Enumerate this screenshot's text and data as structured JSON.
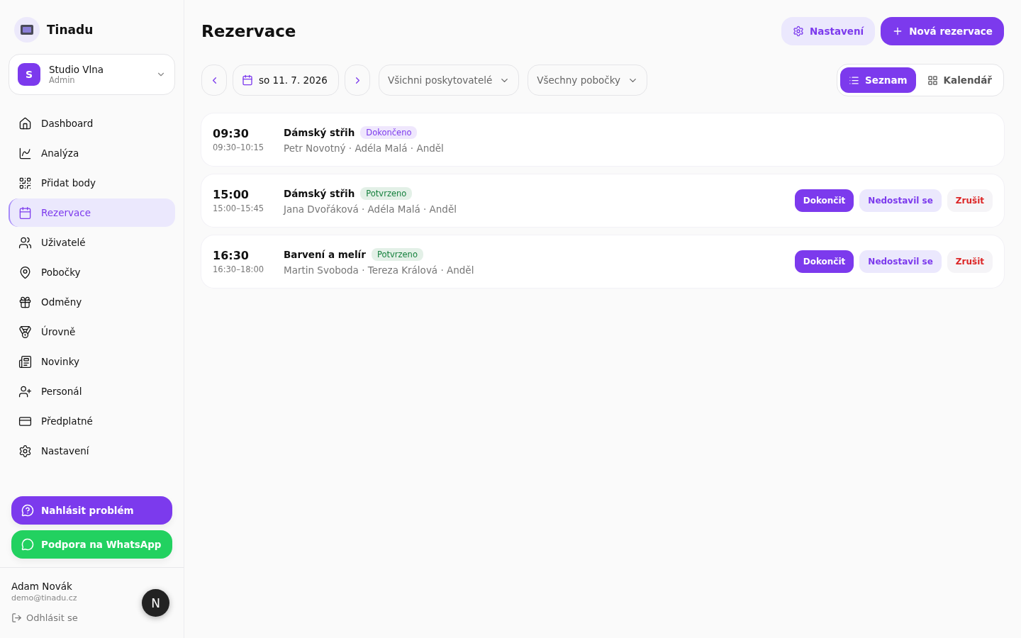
{
  "brand": {
    "name": "Tinadu"
  },
  "workspace": {
    "initial": "S",
    "name": "Studio Vlna",
    "role": "Admin"
  },
  "nav": [
    {
      "kind": "home",
      "label": "Dashboard",
      "selected": false
    },
    {
      "kind": "analytics",
      "label": "Analýza",
      "selected": false
    },
    {
      "kind": "qr",
      "label": "Přidat body",
      "selected": false
    },
    {
      "kind": "calendar",
      "label": "Rezervace",
      "selected": true
    },
    {
      "kind": "users",
      "label": "Uživatelé",
      "selected": false
    },
    {
      "kind": "pin",
      "label": "Pobočky",
      "selected": false
    },
    {
      "kind": "gift",
      "label": "Odměny",
      "selected": false
    },
    {
      "kind": "medal",
      "label": "Úrovně",
      "selected": false
    },
    {
      "kind": "news",
      "label": "Novinky",
      "selected": false
    },
    {
      "kind": "user-plus",
      "label": "Personál",
      "selected": false
    },
    {
      "kind": "card",
      "label": "Předplatné",
      "selected": false
    },
    {
      "kind": "settings",
      "label": "Nastavení",
      "selected": false
    }
  ],
  "support": [
    {
      "kind": "report",
      "label": "Nahlásit problém"
    },
    {
      "kind": "whatsapp",
      "label": "Podpora na WhatsApp"
    }
  ],
  "user": {
    "name": "Adam Novák",
    "email": "demo@tinadu.cz",
    "logout": "Odhlásit se",
    "badge": "N"
  },
  "page": {
    "title": "Rezervace",
    "settings_button": "Nastavení",
    "new_button": "Nová rezervace"
  },
  "filters": {
    "date": "so 11. 7. 2026",
    "provider": "Všichni poskytovatelé",
    "branch": "Všechny pobočky"
  },
  "views": [
    {
      "kind": "list",
      "label": "Seznam",
      "selected": true
    },
    {
      "kind": "calendar",
      "label": "Kalendář",
      "selected": false
    }
  ],
  "reservations": [
    {
      "time": "09:30",
      "range": "09:30–10:15",
      "service": "Dámský střih",
      "status": {
        "label": "Dokončeno",
        "color": "#7c3aed"
      },
      "details": "Petr Novotný · Adéla Malá · Anděl"
    },
    {
      "time": "15:00",
      "range": "15:00–15:45",
      "service": "Dámský střih",
      "status": {
        "label": "Potvrzeno",
        "color": "#15803d"
      },
      "details": "Jana Dvořáková · Adéla Malá · Anděl",
      "actions": [
        {
          "kind": "primary",
          "label": "Dokončit"
        },
        {
          "kind": "secondary",
          "label": "Nedostavil se"
        },
        {
          "kind": "danger",
          "label": "Zrušit"
        }
      ]
    },
    {
      "time": "16:30",
      "range": "16:30–18:00",
      "service": "Barvení a melír",
      "status": {
        "label": "Potvrzeno",
        "color": "#15803d"
      },
      "details": "Martin Svoboda · Tereza Králová · Anděl",
      "actions": [
        {
          "kind": "primary",
          "label": "Dokončit"
        },
        {
          "kind": "secondary",
          "label": "Nedostavil se"
        },
        {
          "kind": "danger",
          "label": "Zrušit"
        }
      ]
    }
  ]
}
